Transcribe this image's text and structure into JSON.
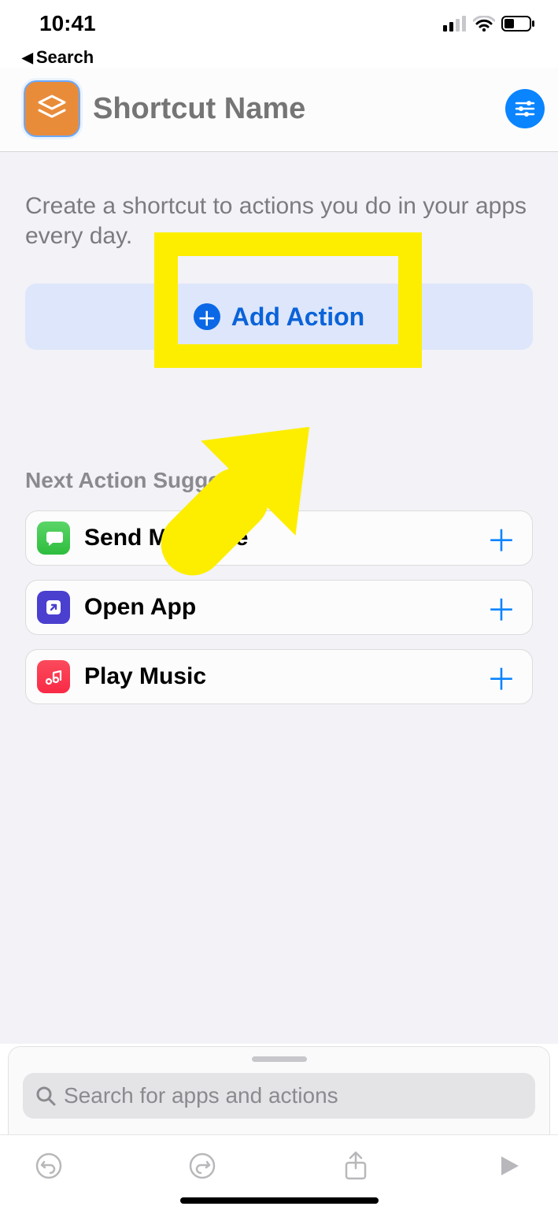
{
  "status": {
    "time": "10:41",
    "back_label": "Search"
  },
  "header": {
    "title_placeholder": "Shortcut Name",
    "accent_color": "#0a84ff"
  },
  "content": {
    "intro": "Create a shortcut to actions you do in your apps every day.",
    "add_action_label": "Add Action",
    "section_title": "Next Action Suggestions"
  },
  "suggestions": [
    {
      "icon": "messages",
      "label": "Send Message"
    },
    {
      "icon": "openapp",
      "label": "Open App"
    },
    {
      "icon": "music",
      "label": "Play Music"
    }
  ],
  "search": {
    "placeholder": "Search for apps and actions"
  }
}
